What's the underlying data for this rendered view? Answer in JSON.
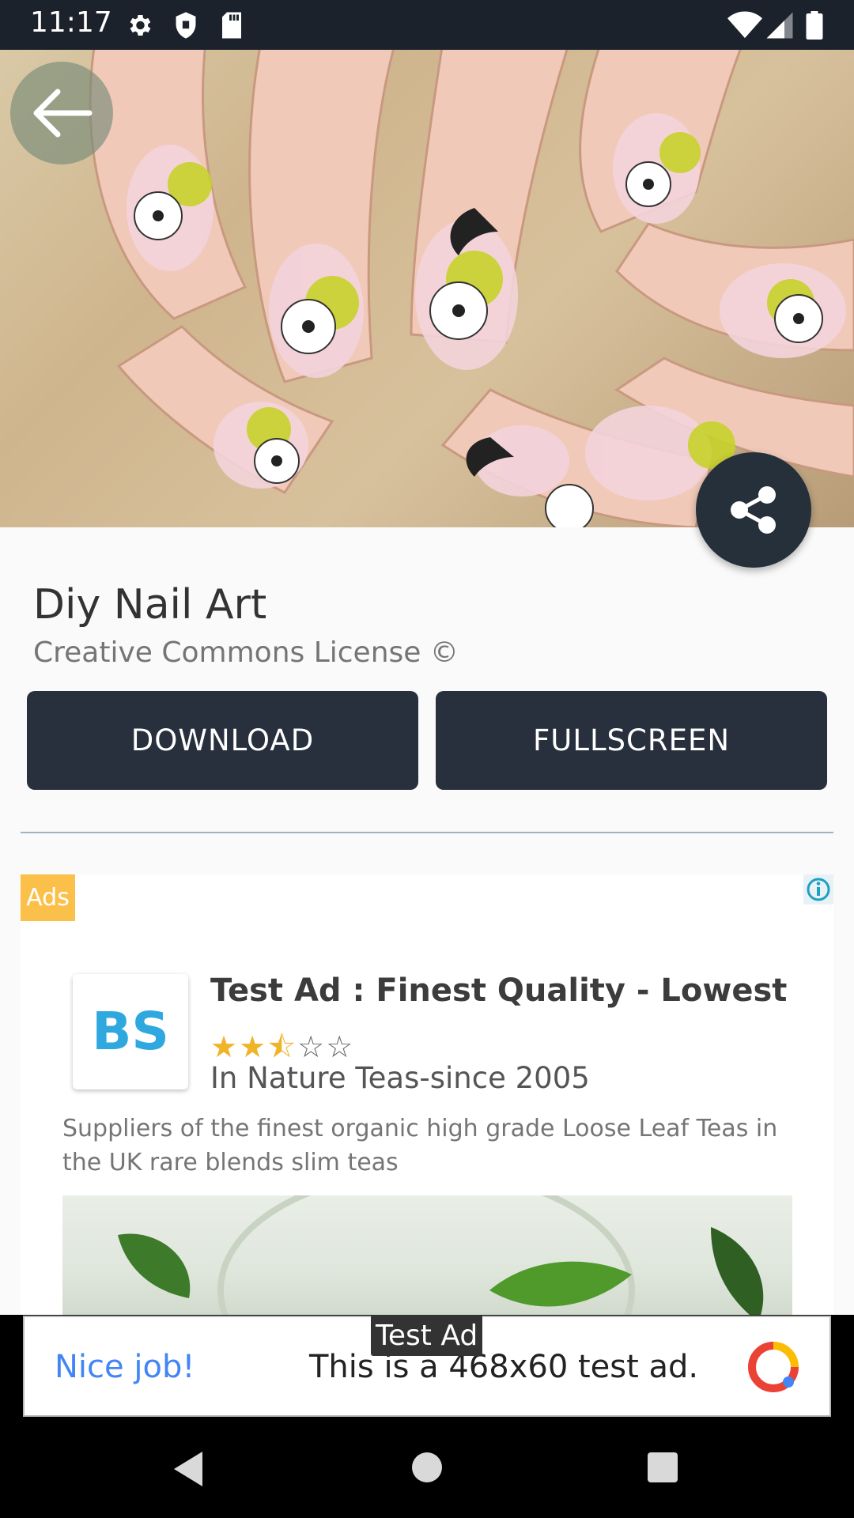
{
  "status_bar": {
    "time": "11:17",
    "icons": [
      "gear-icon",
      "shield-icon",
      "sd-card-icon",
      "wifi-icon",
      "signal-icon",
      "battery-icon"
    ]
  },
  "hero": {
    "back_icon": "arrow-left-icon",
    "share_icon": "share-icon"
  },
  "wallpaper": {
    "title": "Diy Nail Art",
    "license": "Creative Commons License ©"
  },
  "actions": {
    "download_label": "DOWNLOAD",
    "fullscreen_label": "FULLSCREEN"
  },
  "ad_card": {
    "badge": "Ads",
    "headline": "Test Ad : Finest Quality - Lowest Pri",
    "rating": 2.5,
    "rating_max": 5,
    "advertiser": "In Nature Teas-since 2005",
    "body": "Suppliers of the finest organic high grade Loose Leaf Teas in the UK rare blends slim teas",
    "logo_text": "BS"
  },
  "banner": {
    "label": "Test Ad",
    "left_text": "Nice job!",
    "main_text": "This is a 468x60 test ad."
  },
  "nav_bar": {
    "icons": [
      "back-triangle-icon",
      "home-circle-icon",
      "recents-square-icon"
    ]
  },
  "colors": {
    "dark_button": "#27303c",
    "status_bar": "#1c222c",
    "ads_badge": "#fbc04a",
    "star": "#f0b429",
    "banner_link": "#4285f4"
  }
}
